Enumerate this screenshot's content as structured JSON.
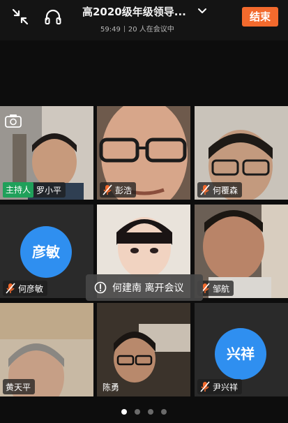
{
  "header": {
    "title": "高2020级年级领导...",
    "timer": "59:49",
    "participants": "20 人在会议中",
    "end_label": "结束"
  },
  "participants": [
    {
      "name": "罗小平",
      "host": true,
      "host_label": "主持人",
      "muted": false
    },
    {
      "name": "彭浩",
      "muted": true
    },
    {
      "name": "何覆森",
      "muted": true
    },
    {
      "name": "何彦敏",
      "muted": true,
      "avatar_text": "彦敏"
    },
    {
      "name": "",
      "muted": false
    },
    {
      "name": "邹航",
      "muted": true
    },
    {
      "name": "黄天平",
      "muted": false
    },
    {
      "name": "陈勇",
      "muted": false
    },
    {
      "name": "尹兴祥",
      "muted": true,
      "avatar_text": "兴祥"
    }
  ],
  "toast": {
    "text": "何建南 离开会议"
  },
  "pagination": {
    "total": 4,
    "current": 1
  },
  "colors": {
    "end_button": "#f36a2d",
    "host_badge": "#1fa05a",
    "avatar": "#2f8ff0",
    "mute_icon": "#f36a2d"
  }
}
